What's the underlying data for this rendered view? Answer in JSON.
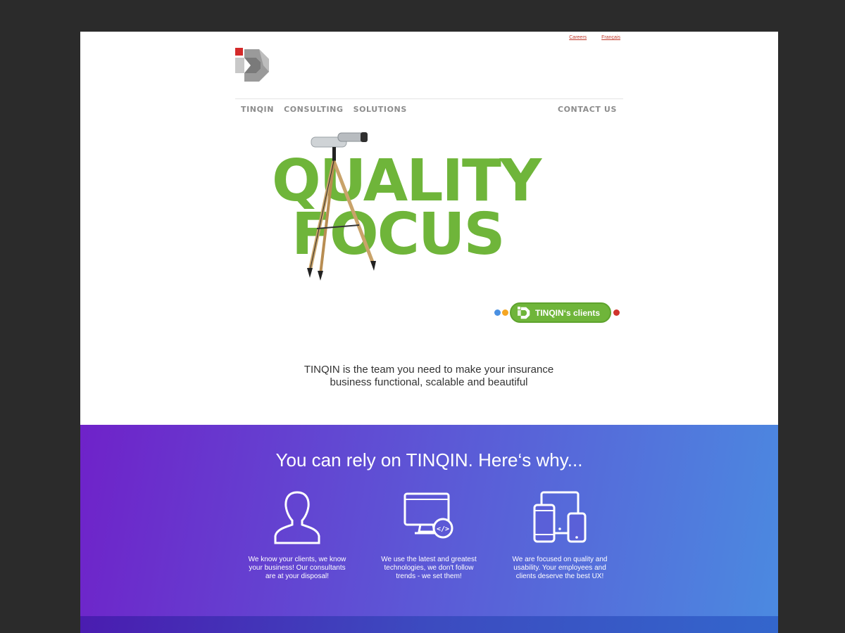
{
  "toplinks": {
    "careers": "Careers",
    "francais": "Français"
  },
  "nav": {
    "tinqin": "TINQIN",
    "consulting": "CONSULTING",
    "solutions": "SOLUTIONS",
    "contact": "CONTACT US"
  },
  "hero": {
    "line1": "QUALITY",
    "line2": "FOCUS"
  },
  "clients_button": {
    "label": "TINQIN‘s clients"
  },
  "tagline": {
    "line1": "TINQIN is the team you need to make your insurance",
    "line2": "business functional, scalable and beautiful"
  },
  "why": {
    "title": "You can rely on TINQIN. Here‘s why...",
    "features": [
      {
        "icon": "user-icon",
        "text": "We know your clients, we know your business! Our consultants are at your disposal!"
      },
      {
        "icon": "monitor-code-icon",
        "text": "We use the latest and greatest technologies, we don't follow trends - we set them!"
      },
      {
        "icon": "devices-icon",
        "text": "We are focused on quality and usability. Your employees and clients deserve the best UX!"
      }
    ]
  },
  "colors": {
    "brand_green": "#6fb53a",
    "gradient_start": "#6f22c9",
    "gradient_end": "#4b8ae0",
    "link_red": "#c0392b"
  }
}
